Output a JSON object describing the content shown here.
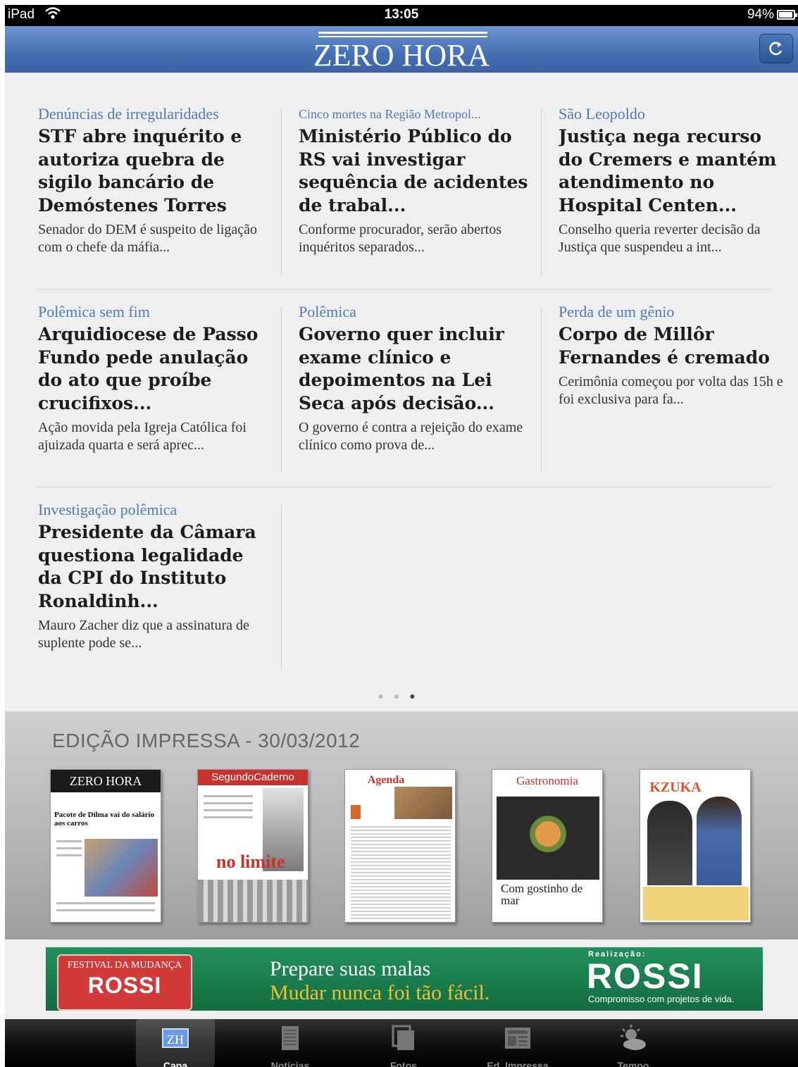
{
  "status_bar": {
    "device": "iPad",
    "time": "13:05",
    "battery": "94%",
    "battery_level": 0.94
  },
  "header": {
    "logo": "ZERO HORA"
  },
  "articles": [
    {
      "category": "Denúncias de irregularidades",
      "headline": "STF abre inquérito e autoriza quebra de sigilo bancário de Demóstenes Torres",
      "summary": "Senador do DEM é suspeito de ligação com o chefe da máfia..."
    },
    {
      "category": "Cinco mortes na Região Metropol...",
      "headline": "Ministério Público do RS vai investigar sequência de acidentes de trabal...",
      "summary": "Conforme procurador, serão abertos inquéritos separados..."
    },
    {
      "category": "São Leopoldo",
      "headline": "Justiça nega recurso do Cremers e mantém atendimento no Hospital Centen...",
      "summary": "Conselho queria reverter decisão da Justiça que suspendeu a int..."
    },
    {
      "category": "Polêmica sem fim",
      "headline": "Arquidiocese de Passo Fundo pede anulação do ato que proíbe crucifixos...",
      "summary": "Ação movida pela Igreja Católica foi ajuizada quarta e será aprec..."
    },
    {
      "category": "Polêmica",
      "headline": "Governo quer incluir exame clínico e depoimentos na Lei Seca após decisão...",
      "summary": "O governo é contra a rejeição do exame clínico como prova de..."
    },
    {
      "category": "Perda de um gênio",
      "headline": "Corpo de Millôr Fernandes é cremado",
      "summary": "Cerimônia começou por volta das 15h e foi exclusiva para fa..."
    },
    {
      "category": "Investigação polêmica",
      "headline": "Presidente da Câmara questiona legalidade da CPI do Instituto Ronaldinh...",
      "summary": "Mauro Zacher diz que a assinatura de suplente pode se..."
    }
  ],
  "pager": {
    "count": 3,
    "active": 3
  },
  "print_edition": {
    "title": "EDIÇÃO IMPRESSA - 30/03/2012",
    "covers": [
      {
        "title": "ZERO HORA",
        "headline": "Pacote de Dilma vai do salário aos carros"
      },
      {
        "title": "SegundoCaderno",
        "headline": "no limite"
      },
      {
        "title": "Agenda",
        "headline": ""
      },
      {
        "title": "Gastronomia",
        "headline": "Com gostinho de mar"
      },
      {
        "title": "KZUKA",
        "headline": ""
      }
    ]
  },
  "ad": {
    "badge_top": "FESTIVAL DA MUDANÇA",
    "badge_brand": "ROSSI",
    "line1": "Prepare suas malas",
    "line2": "Mudar nunca foi tão fácil.",
    "realizacao": "Realização:",
    "brand": "ROSSI",
    "tagline": "Compromisso com projetos de vida."
  },
  "tabs": [
    {
      "label": "Capa",
      "icon": "zh-logo-icon",
      "active": true
    },
    {
      "label": "Notícias",
      "icon": "news-icon",
      "active": false
    },
    {
      "label": "Fotos",
      "icon": "photos-icon",
      "active": false
    },
    {
      "label": "Ed. Impressa",
      "icon": "print-edition-icon",
      "active": false
    },
    {
      "label": "Tempo",
      "icon": "weather-icon",
      "active": false
    }
  ],
  "colors": {
    "header_blue": "#4670b4",
    "category_blue": "#4d7ab8",
    "ad_green": "#1a7d4e",
    "ad_red": "#d23a3a",
    "ad_yellow": "#f0c030"
  }
}
